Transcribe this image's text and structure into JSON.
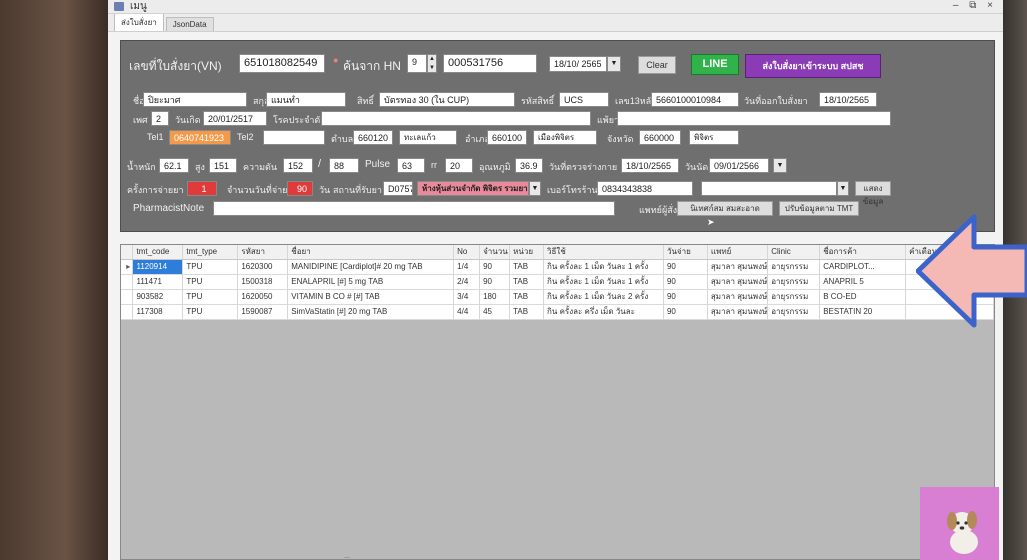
{
  "window": {
    "title": "เมนู",
    "controls": "–  ⧉  ×"
  },
  "tabs": [
    "ส่งใบสั่งยา",
    "JsonData"
  ],
  "header": {
    "vn_label": "เลขที่ใบสั่งยา(VN)",
    "vn_value": "651018082549",
    "hn_label": "ค้นจาก HN",
    "hn_spin": "9",
    "hn_value": "000531756",
    "date_value": "18/10/ 2565",
    "clear_label": "Clear",
    "line_label": "LINE",
    "send_label": "ส่งใบสั่งยาเข้าระบบ สปสช"
  },
  "patient": {
    "name_label": "ชื่อ",
    "name_value": "ปิยะมาศ",
    "surname_label": "สกุล",
    "surname_value": "แมนทำ",
    "right_label": "สิทธิ์",
    "right_value": "บัตรทอง 30 (ใน CUP)",
    "rightcode_label": "รหัสสิทธิ์",
    "rightcode_value": "UCS",
    "id_label": "เลข13หลัก",
    "id_value": "5660100010984",
    "visit_label": "วันที่ออกใบสั่งยา",
    "visit_value": "18/10/2565",
    "sex_label": "เพศ",
    "sex_value": "2",
    "birth_label": "วันเกิด",
    "birth_value": "20/01/2517",
    "cid_label": "โรคประจำตัว",
    "cid_value": "",
    "allergy_label": "แพ้ยา",
    "allergy_value": "",
    "tel1_label": "Tel1",
    "tel1_value": "0640741923",
    "tel2_label": "Tel2",
    "tel2_value": "",
    "tambon_label": "ตำบล",
    "tambon_value": "660120",
    "tambon_name": "ทะเลแก้ว",
    "amphur_label": "อำเภอ",
    "amphur_value": "660100",
    "amphur_name": "เมืองพิจิตร",
    "changwat_label": "จังหวัด",
    "changwat_value": "660000",
    "changwat_name": "พิจิตร"
  },
  "vitals": {
    "weight_label": "น้ำหนัก",
    "weight_value": "62.1",
    "height_label": "สูง",
    "height_value": "151",
    "bp_label": "ความดัน",
    "bp_sys": "152",
    "bp_sep": "/",
    "bp_dia": "88",
    "pulse_label": "Pulse",
    "pulse_value": "63",
    "rr_label": "rr",
    "rr_value": "20",
    "temp_label": "อุณหภูมิ",
    "temp_value": "36.9",
    "checkdate_label": "วันที่ตรวจร่างกาย",
    "checkdate_value": "18/10/2565",
    "appt_label": "วันนัด",
    "appt_value": "09/01/2566"
  },
  "dispense": {
    "count_label": "ครั้งการจ่ายยา",
    "count_value": "1",
    "days_label": "จำนวนวันที่จ่าย",
    "days_value": "90",
    "days_unit": "วัน",
    "place_label": "สถานที่รับยา",
    "place_code": "D0757",
    "place_name": "ห้างหุ้นส่วนจำกัด พิจิตร รวมยา",
    "phone_label": "เบอร์โทรร้าน",
    "phone_value": "0834343838",
    "check_label": "แสดงข้อมูล",
    "pharm_label": "PharmacistNote",
    "pharm_value": "",
    "doctor_label": "แพทย์ผู้สั่ง",
    "doctor_value": "นิเทศก์สม สมสะอาด",
    "tmt_label": "ปรับข้อมูลตาม TMT"
  },
  "grid": {
    "columns": [
      "tmt_code",
      "tmt_type",
      "รหัสยา",
      "ชื่อยา",
      "No",
      "จำนวน",
      "หน่วย",
      "วิธีใช้",
      "วันจ่าย",
      "แพทย์",
      "Clinic",
      "ชื่อการค้า",
      "คำเตือน"
    ],
    "rows": [
      [
        "1120914",
        "TPU",
        "1620300",
        "MANIDIPINE [Cardiplot]# 20 mg TAB",
        "1/4",
        "90",
        "TAB",
        "กิน ครั้งละ 1 เม็ด วันละ 1 ครั้ง",
        "90",
        "สุมาลา สุมนพงษ์",
        "อายุรกรรม",
        "CARDIPLOT..."
      ],
      [
        "111471",
        "TPU",
        "1500318",
        "ENALAPRIL [#] 5 mg TAB",
        "2/4",
        "90",
        "TAB",
        "กิน ครั้งละ 1 เม็ด วันละ 1 ครั้ง",
        "90",
        "สุมาลา สุมนพงษ์",
        "อายุรกรรม",
        "ANAPRIL 5"
      ],
      [
        "903582",
        "TPU",
        "1620050",
        "VITAMIN B CO # [#] TAB",
        "3/4",
        "180",
        "TAB",
        "กิน ครั้งละ 1 เม็ด วันละ 2 ครั้ง",
        "90",
        "สุมาลา สุมนพงษ์",
        "อายุรกรรม",
        "B CO-ED"
      ],
      [
        "117308",
        "TPU",
        "1590087",
        "SimVaStatin [#] 20 mg TAB",
        "4/4",
        "45",
        "TAB",
        "กิน ครั้งละ ครึ่ง เม็ด วันละ",
        "90",
        "สุมาลา สุมนพงษ์",
        "อายุรกรรม",
        "BESTATIN 20"
      ]
    ]
  },
  "statusbar": {
    "text": "..."
  },
  "colors": {
    "accent_line": "#2fb34a",
    "accent_send": "#8b3bb5",
    "tel_highlight": "#f29a4a",
    "count_highlight": "#e03b3b",
    "selected_row": "#2e7dd8",
    "arrow_fill": "#f4b8b5",
    "arrow_stroke": "#3b63c9"
  }
}
